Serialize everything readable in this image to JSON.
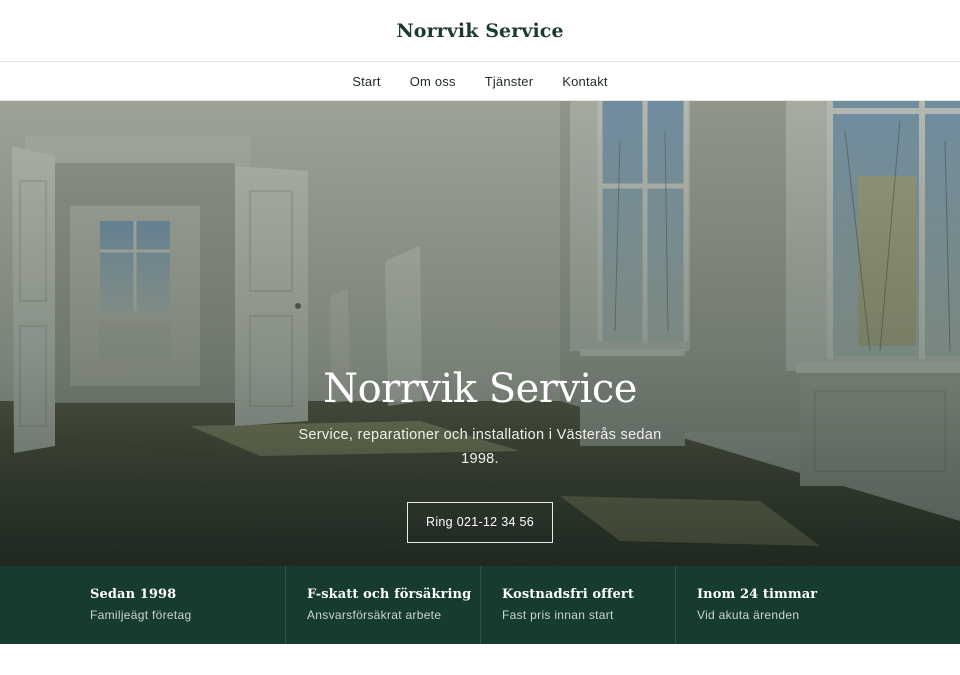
{
  "header": {
    "title": "Norrvik Service"
  },
  "nav": {
    "items": [
      {
        "label": "Start"
      },
      {
        "label": "Om oss"
      },
      {
        "label": "Tjänster"
      },
      {
        "label": "Kontakt"
      }
    ]
  },
  "hero": {
    "title": "Norrvik Service",
    "subtitle": "Service, reparationer och installation i Västerås sedan 1998.",
    "cta_label": "Ring 021-12 34 56"
  },
  "features": [
    {
      "title": "Sedan 1998",
      "text": "Familjeägt företag"
    },
    {
      "title": "F-skatt och försäkring",
      "text": "Ansvarsförsäkrat arbete"
    },
    {
      "title": "Kostnadsfri offert",
      "text": "Fast pris innan start"
    },
    {
      "title": "Inom 24 timmar",
      "text": "Vid akuta ärenden"
    }
  ],
  "colors": {
    "brand": "#1b3a30",
    "band": "#163b31",
    "overlay": "#1e3328"
  }
}
